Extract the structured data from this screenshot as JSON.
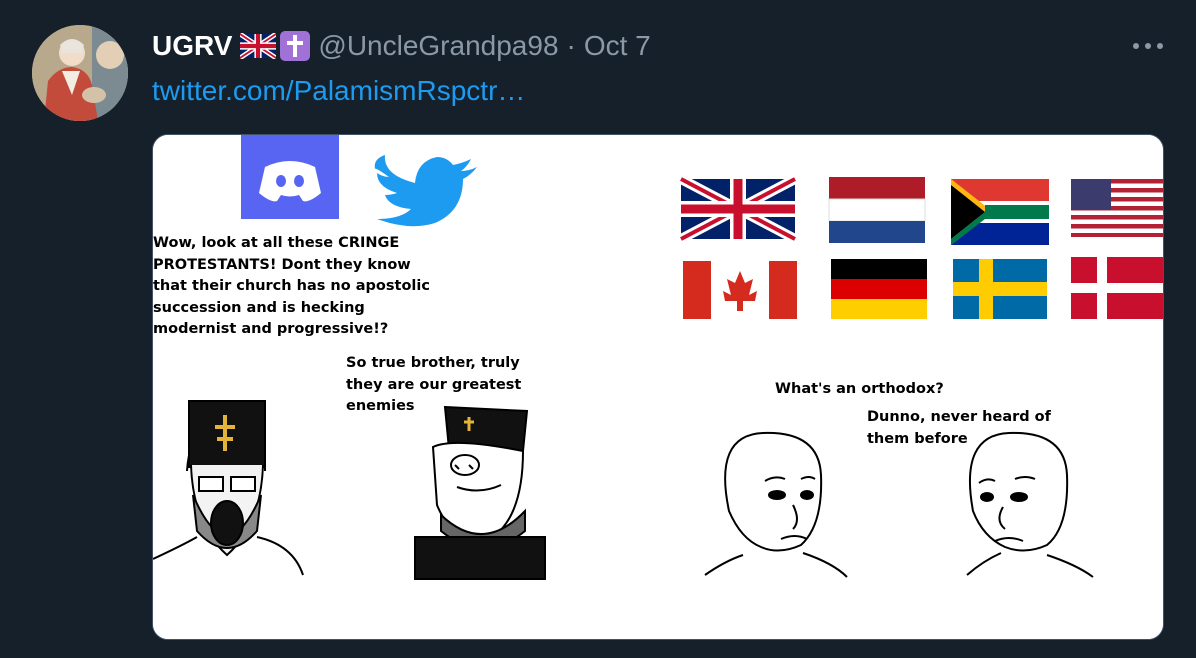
{
  "tweet": {
    "display_name": "UGRV",
    "badges": [
      "uk-flag-emoji",
      "latin-cross-emoji"
    ],
    "handle": "@UncleGrandpa98",
    "separator": "·",
    "timestamp": "Oct 7",
    "link_text": "twitter.com/PalamismRspctr…",
    "more_icon": "more-horizontal-icon",
    "avatar_icon": "avatar-painting"
  },
  "media": {
    "panel_left": {
      "logos": [
        "discord-logo",
        "twitter-bird-logo"
      ],
      "caption_1": "Wow, look at all these CRINGE\nPROTESTANTS! Dont they know\nthat their church has no apostolic\nsuccession and is hecking\nmodernist and progressive!?",
      "caption_2": "So true brother, truly\nthey are our greatest\nenemies"
    },
    "panel_right": {
      "flags": [
        "uk",
        "netherlands",
        "south-africa",
        "usa",
        "canada",
        "germany",
        "sweden",
        "denmark"
      ],
      "caption_1": "What's an orthodox?",
      "caption_2": "Dunno, never heard of\nthem before"
    }
  },
  "colors": {
    "background": "#15202b",
    "link": "#1d9bf0",
    "muted": "#8b98a5",
    "discord": "#5865f2",
    "twitter": "#1d9bf0"
  }
}
